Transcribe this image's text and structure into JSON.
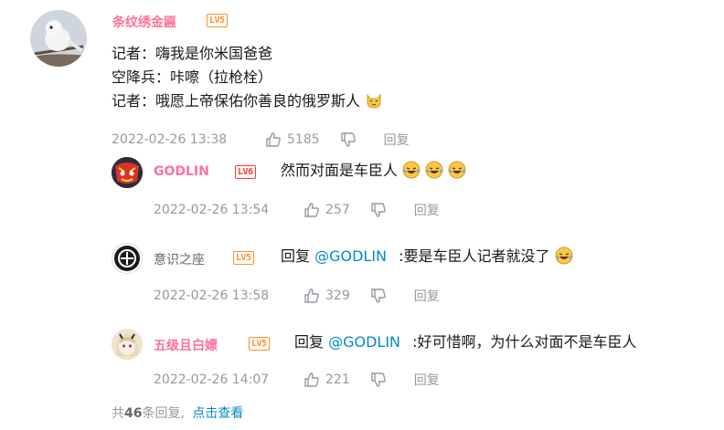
{
  "main_comment": {
    "username": "条纹绣金匾",
    "level": "LV5",
    "lines": [
      "记者：嗨我是你米国爸爸",
      "空降兵：咔嚓（拉枪栓）",
      "记者：哦愿上帝保佑你善良的俄罗斯人"
    ],
    "timestamp": "2022-02-26 13:38",
    "likes": "5185",
    "reply_label": "回复"
  },
  "replies": [
    {
      "username": "GODLIN",
      "level": "LV6",
      "text": "然而对面是车臣人",
      "mention": "",
      "reply_prefix": "",
      "timestamp": "2022-02-26 13:54",
      "likes": "257",
      "reply_label": "回复"
    },
    {
      "username": "意识之座",
      "level": "LV5",
      "reply_prefix": "回复",
      "mention": "@GODLIN",
      "text": ":要是车臣人记者就没了",
      "timestamp": "2022-02-26 13:58",
      "likes": "329",
      "reply_label": "回复"
    },
    {
      "username": "五级且白嫖",
      "level": "LV5",
      "reply_prefix": "回复",
      "mention": "@GODLIN",
      "text": ":好可惜啊，为什么对面不是车臣人",
      "timestamp": "2022-02-26 14:07",
      "likes": "221",
      "reply_label": "回复"
    }
  ],
  "footer": {
    "prefix": "共",
    "count": "46",
    "suffix": "条回复,",
    "view_more": "点击查看"
  },
  "colors": {
    "username_pink": "#fb7299",
    "level_orange": "#ff8e29",
    "level_red": "#ff3c28",
    "link_blue": "#008ac5",
    "meta_gray": "#9499a0"
  }
}
